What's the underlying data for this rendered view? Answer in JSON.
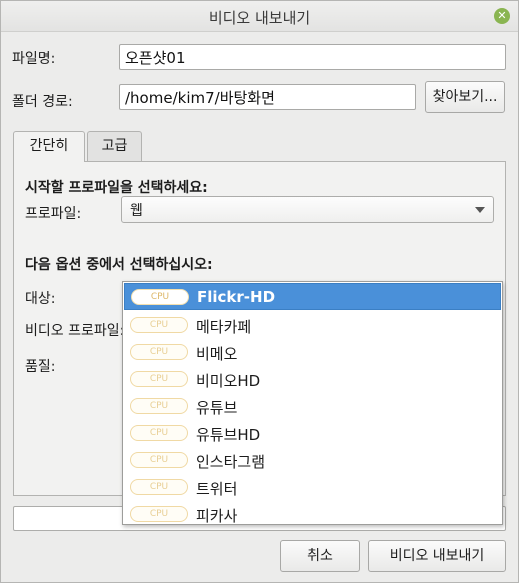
{
  "window": {
    "title": "비디오 내보내기",
    "close_icon": "close-icon"
  },
  "filename": {
    "label": "파일명:",
    "value": "오픈샷01"
  },
  "folder": {
    "label": "폴더 경로:",
    "value": "/home/kim7/바탕화면",
    "browse_label": "찾아보기..."
  },
  "tabs": [
    {
      "label": "간단히",
      "active": true
    },
    {
      "label": "고급",
      "active": false
    }
  ],
  "simple": {
    "profile_heading": "시작할 프로파일을 선택하세요:",
    "profile_label": "프로파일:",
    "profile_value": "웹",
    "options_heading": "다음 옵션 중에서 선택하십시오:",
    "target_label": "대상:",
    "video_profile_label": "비디오 프로파일:",
    "quality_label": "품질:"
  },
  "dropdown": {
    "badge": "CPU",
    "items": [
      {
        "label": "Flickr-HD",
        "selected": true
      },
      {
        "label": "메타카페",
        "selected": false
      },
      {
        "label": "비메오",
        "selected": false
      },
      {
        "label": "비미오HD",
        "selected": false
      },
      {
        "label": "유튜브",
        "selected": false
      },
      {
        "label": "유튜브HD",
        "selected": false
      },
      {
        "label": "인스타그램",
        "selected": false
      },
      {
        "label": "트위터",
        "selected": false
      },
      {
        "label": "피카사",
        "selected": false
      }
    ]
  },
  "footer": {
    "cancel_label": "취소",
    "export_label": "비디오 내보내기"
  },
  "colors": {
    "selection": "#4a90d9",
    "close_button": "#8ab551",
    "cpu_badge": "#f0d9a4"
  }
}
